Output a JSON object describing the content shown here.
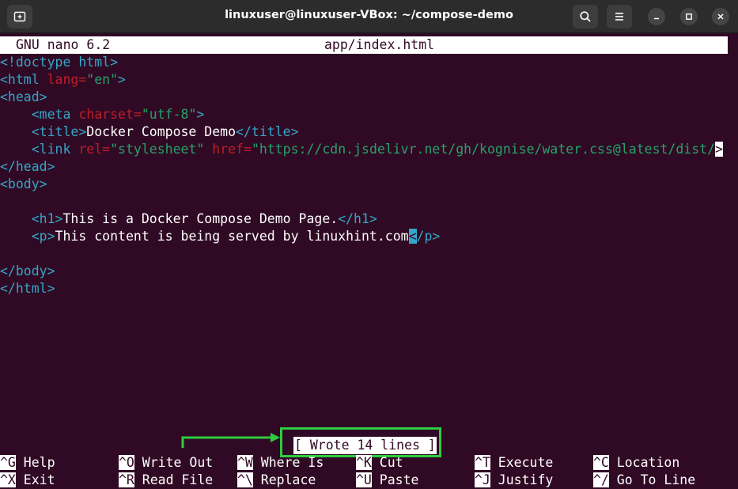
{
  "window": {
    "title": "linuxuser@linuxuser-VBox: ~/compose-demo",
    "left_icon": "new-tab-icon",
    "right_icons": [
      "search-icon",
      "hamburger-menu-icon",
      "minimize-icon",
      "maximize-icon",
      "close-icon"
    ]
  },
  "nano": {
    "app": "GNU nano 6.2",
    "filename": "app/index.html",
    "lines": [
      [
        [
          "tag",
          "<!doctype html>"
        ]
      ],
      [
        [
          "tag",
          "<html "
        ],
        [
          "attr",
          "lang="
        ],
        [
          "str",
          "\"en\""
        ],
        [
          "tag",
          ">"
        ]
      ],
      [
        [
          "tag",
          "<head>"
        ]
      ],
      [
        [
          "txt",
          "    "
        ],
        [
          "tag",
          "<meta "
        ],
        [
          "attr",
          "charset="
        ],
        [
          "str",
          "\"utf-8\""
        ],
        [
          "tag",
          ">"
        ]
      ],
      [
        [
          "txt",
          "    "
        ],
        [
          "tag",
          "<title>"
        ],
        [
          "txt",
          "Docker Compose Demo"
        ],
        [
          "tag",
          "</title>"
        ]
      ],
      [
        [
          "txt",
          "    "
        ],
        [
          "tag",
          "<link "
        ],
        [
          "attr",
          "rel="
        ],
        [
          "str",
          "\"stylesheet\""
        ],
        [
          "txt",
          " "
        ],
        [
          "attr",
          "href="
        ],
        [
          "str",
          "\"https://cdn.jsdelivr.net/gh/kognise/water.css@latest/dist/"
        ],
        [
          "trunc",
          ">"
        ]
      ],
      [
        [
          "tag",
          "</head>"
        ]
      ],
      [
        [
          "tag",
          "<body>"
        ]
      ],
      [
        [
          "txt",
          ""
        ]
      ],
      [
        [
          "txt",
          "    "
        ],
        [
          "tag",
          "<h1>"
        ],
        [
          "txt",
          "This is a Docker Compose Demo Page."
        ],
        [
          "tag",
          "</h1>"
        ]
      ],
      [
        [
          "txt",
          "    "
        ],
        [
          "tag",
          "<p>"
        ],
        [
          "txt",
          "This content is being served by linuxhint.com"
        ],
        [
          "cursor",
          "<"
        ],
        [
          "tag",
          "/p>"
        ]
      ],
      [
        [
          "txt",
          ""
        ]
      ],
      [
        [
          "tag",
          "</body>"
        ]
      ],
      [
        [
          "tag",
          "</html>"
        ]
      ]
    ],
    "status": "[ Wrote 14 lines ]",
    "shortcuts": [
      [
        {
          "key": "^G",
          "label": "Help"
        },
        {
          "key": "^O",
          "label": "Write Out"
        },
        {
          "key": "^W",
          "label": "Where Is"
        },
        {
          "key": "^K",
          "label": "Cut"
        },
        {
          "key": "^T",
          "label": "Execute"
        },
        {
          "key": "^C",
          "label": "Location"
        }
      ],
      [
        {
          "key": "^X",
          "label": "Exit"
        },
        {
          "key": "^R",
          "label": "Read File"
        },
        {
          "key": "^\\",
          "label": "Replace"
        },
        {
          "key": "^U",
          "label": "Paste"
        },
        {
          "key": "^J",
          "label": "Justify"
        },
        {
          "key": "^/",
          "label": "Go To Line"
        }
      ]
    ]
  },
  "colors": {
    "terminal_bg": "#300a24",
    "tag": "#34a6c8",
    "attribute": "#c01c28",
    "string": "#26a269",
    "highlight_box": "#2ecc40"
  }
}
